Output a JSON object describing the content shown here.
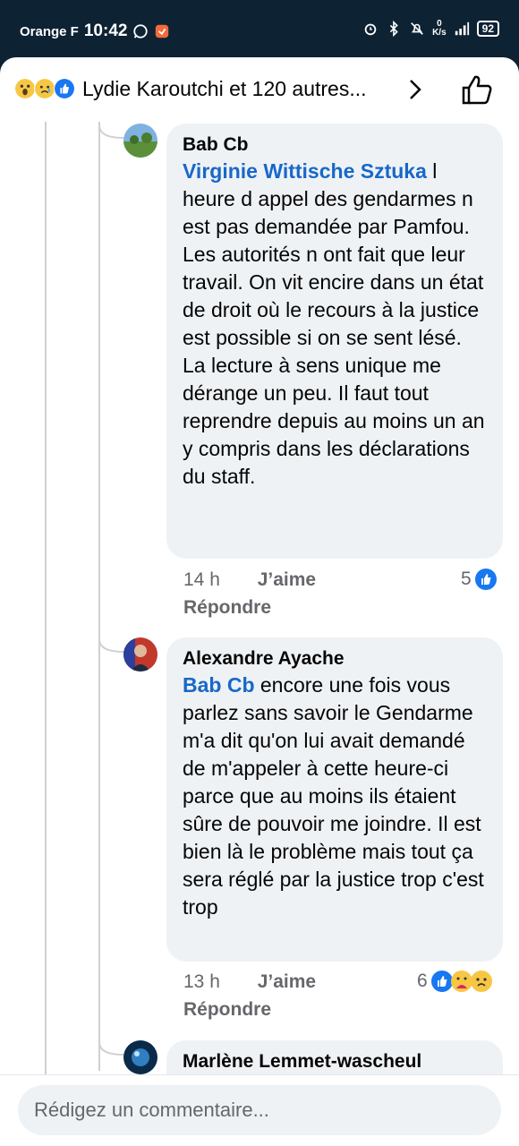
{
  "status": {
    "carrier": "Orange F",
    "time": "10:42",
    "speed_top": "0",
    "speed_bottom": "K/s",
    "battery": "92"
  },
  "header": {
    "reactors": "Lydie Karoutchi et 120 autres...",
    "reaction_icons": [
      "wow-icon",
      "sad-icon",
      "like-icon"
    ]
  },
  "comments": [
    {
      "author": "Bab Cb",
      "mention": "Virginie Wittische Sztuka",
      "text": " l heure d appel des gendarmes n est pas demandée par Pamfou. Les autorités n ont fait que leur travail. On vit encire dans un état de droit où le recours à la justice est possible si on se sent lésé. La lecture à sens unique me dérange un peu. Il faut tout reprendre depuis au moins un an y compris dans les déclarations du staff.",
      "time": "14 h",
      "like_label": "J’aime",
      "reply_label": "Répondre",
      "reaction_count": "5"
    },
    {
      "author": "Alexandre Ayache",
      "mention": "Bab Cb",
      "text": " encore une fois vous parlez sans savoir le Gendarme m'a dit qu'on lui avait demandé de m'appeler à cette heure-ci parce que au moins ils étaient sûre de pouvoir me joindre. Il est bien là le problème mais tout ça sera réglé par la justice trop c'est trop",
      "time": "13 h",
      "like_label": "J’aime",
      "reply_label": "Répondre",
      "reaction_count": "6"
    },
    {
      "author": "Marlène Lemmet-wascheul"
    }
  ],
  "composer": {
    "placeholder": "Rédigez un commentaire..."
  },
  "colors": {
    "mention": "#1868c8",
    "bubble": "#eff2f5",
    "statusbar": "#0d2233",
    "like_blue": "#1877f2"
  }
}
